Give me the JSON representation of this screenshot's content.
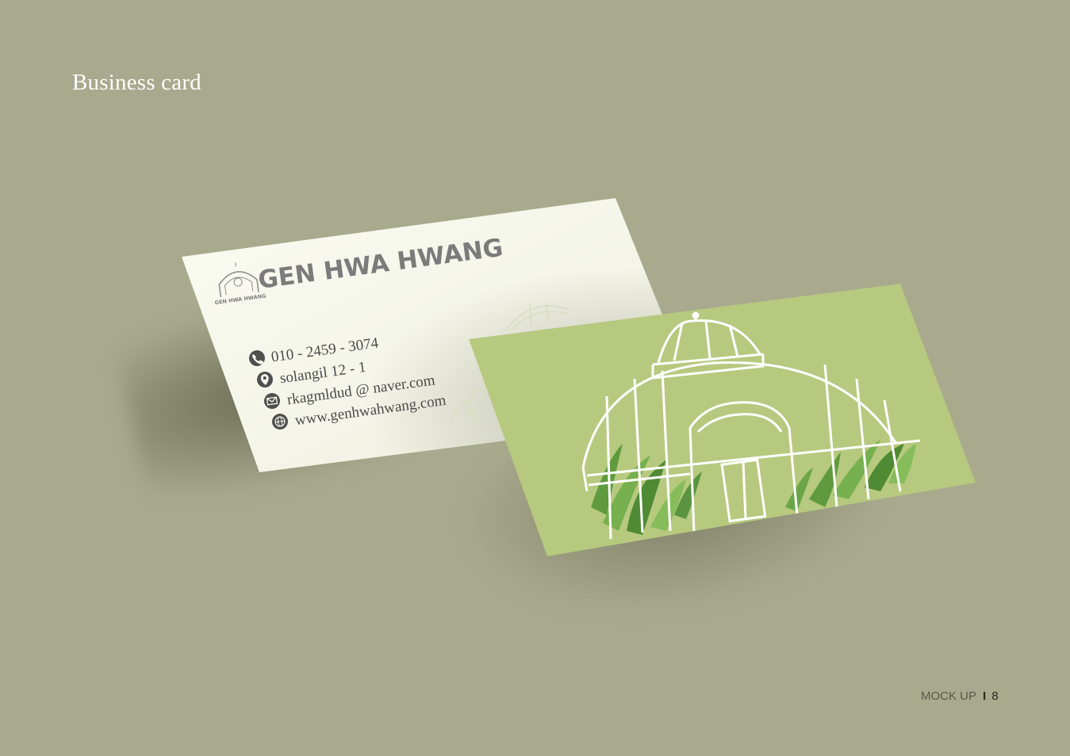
{
  "page": {
    "title": "Business card",
    "footer_section": "MOCK UP",
    "footer_separator": "I",
    "footer_page": "8"
  },
  "card_front": {
    "brand_name": "GEN HWA HWANG",
    "logo_caption": "GEN HWA HWANG",
    "contacts": [
      {
        "icon": "phone-icon",
        "text": "010 - 2459 - 3074"
      },
      {
        "icon": "location-icon",
        "text": "solangil 12 - 1"
      },
      {
        "icon": "mail-icon",
        "text": "rkagmldud @ naver.com"
      },
      {
        "icon": "globe-icon",
        "text": "www.genhwahwang.com"
      }
    ]
  },
  "card_back": {
    "illustration": "greenhouse-illustration"
  },
  "colors": {
    "background": "#a8a98d",
    "card_front": "#f6f7ec",
    "card_back": "#b7c97f",
    "brand_text": "#7b7b7b"
  }
}
